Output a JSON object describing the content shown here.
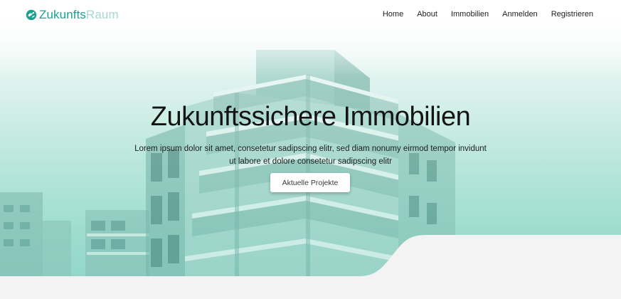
{
  "brand": {
    "name_part1": "Zukunfts",
    "name_part2": "Raum",
    "logo_icon": "globe-leaf-icon",
    "accent_color": "#1aa190",
    "accent_light": "#a6d9d0"
  },
  "nav": {
    "items": [
      {
        "label": "Home"
      },
      {
        "label": "About"
      },
      {
        "label": "Immobilien"
      },
      {
        "label": "Anmelden"
      },
      {
        "label": "Registrieren"
      }
    ]
  },
  "hero": {
    "title": "Zukunftssichere Immobilien",
    "subtitle_line1": "Lorem ipsum dolor sit amet, consetetur sadipscing elitr, sed diam nonumy eirmod tempor invidunt",
    "subtitle_line2": "ut labore et dolore consetetur sadipscing elitr",
    "cta_label": "Aktuelle Projekte",
    "background_image": "modern-apartment-building",
    "tint_color": "#93d8cb"
  }
}
